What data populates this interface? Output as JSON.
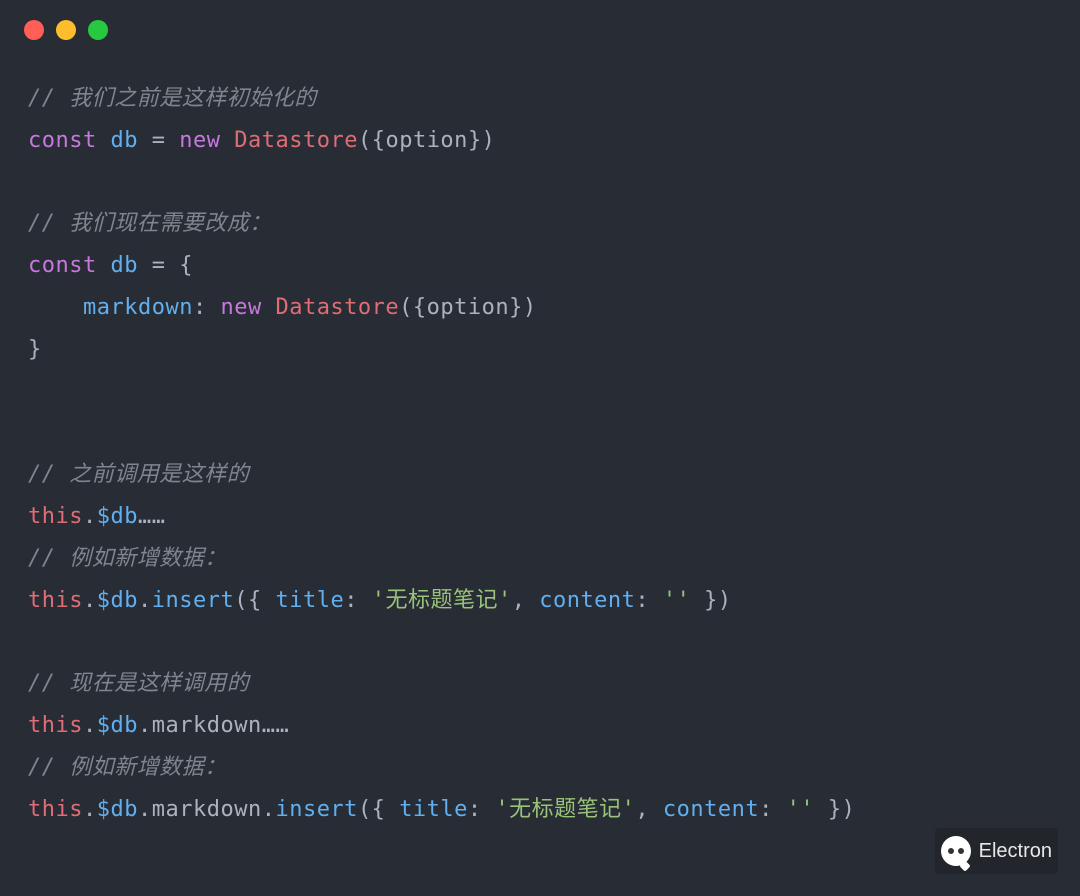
{
  "code": {
    "comment1": "// 我们之前是这样初始化的",
    "kw_const": "const",
    "var_db": "db",
    "op_eq": " = ",
    "kw_new": "new",
    "cls_datastore": "Datastore",
    "paren_open_brace": "({",
    "opt": "option",
    "brace_close_paren": "})",
    "comment2": "// 我们现在需要改成：",
    "obj_open": " = {",
    "indent": "    ",
    "prop_markdown": "markdown",
    "colon": ": ",
    "obj_close": "}",
    "comment3": "// 之前调用是这样的",
    "thisref": "this",
    "dot": ".",
    "dollar_db": "$db",
    "ellipsis": "……",
    "comment4": "// 例如新增数据：",
    "method_insert": "insert",
    "insert_open": "({ ",
    "prop_title": "title",
    "str_title": "'无标题笔记'",
    "comma": ", ",
    "prop_content": "content",
    "str_empty": "''",
    "insert_close": " })",
    "comment5": "// 现在是这样调用的",
    "markdown": "markdown",
    "comment6": "// 例如新增数据："
  },
  "watermark": {
    "label": "Electron"
  }
}
